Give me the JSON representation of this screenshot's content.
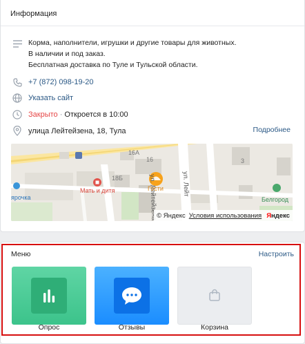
{
  "info": {
    "header": "Информация",
    "description": [
      "Корма, наполнители, игрушки и другие товары для животных.",
      "В наличии и под заказ.",
      "Бесплатная доставка по Туле и Тульской области."
    ],
    "phone": "+7 (872) 098-19-20",
    "website_label": "Указать сайт",
    "status": "Закрыто",
    "status_sep": " · ",
    "opens": "Откроется в 10:00",
    "address": "улица Лейтейзена, 18, Тула",
    "more_label": "Подробнее"
  },
  "map": {
    "labels": {
      "building_16a": "16А",
      "building_16": "16",
      "building_18b": "18Б",
      "building_3": "3",
      "street_1": "ул. Лейтейзена",
      "street_2": "ул. Лейт",
      "poi_mother": "Мать и дитя",
      "poi_guests": "Гости",
      "poi_left": "ярочка",
      "poi_belgorod": "Белгород"
    },
    "copyright": "© Яндекс",
    "terms": "Условия использования",
    "logo_first": "Я",
    "logo_rest": "ндекс"
  },
  "menu": {
    "title": "Меню",
    "configure_label": "Настроить",
    "tiles": [
      {
        "label": "Опрос",
        "icon": "bar-chart-icon"
      },
      {
        "label": "Отзывы",
        "icon": "speech-bubble-icon"
      },
      {
        "label": "Корзина",
        "icon": "shopping-bag-icon"
      }
    ]
  },
  "colors": {
    "accent_link": "#2a5885",
    "closed": "#e64646",
    "poll_green": "#3cc38b",
    "reviews_blue": "#1b8dff",
    "highlight_red": "#d60d0d"
  }
}
